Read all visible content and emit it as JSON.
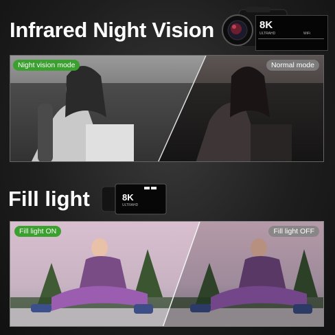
{
  "section_top": {
    "title": "Infrared Night Vision",
    "left_badge": "Night vision mode",
    "right_badge": "Normal mode"
  },
  "section_bottom": {
    "title": "Fill light",
    "left_badge": "Fill light ON",
    "right_badge": "Fill light OFF"
  },
  "camera_top": {
    "resolution": "8K",
    "sub": "ULTRAHD",
    "wifi": "WiFi"
  },
  "camera_bottom": {
    "resolution": "8K",
    "sub": "ULTRAHD"
  },
  "colors": {
    "badge_on": "#3aa02e",
    "badge_off": "#8a8a8a",
    "background": "#1e1e1e"
  }
}
